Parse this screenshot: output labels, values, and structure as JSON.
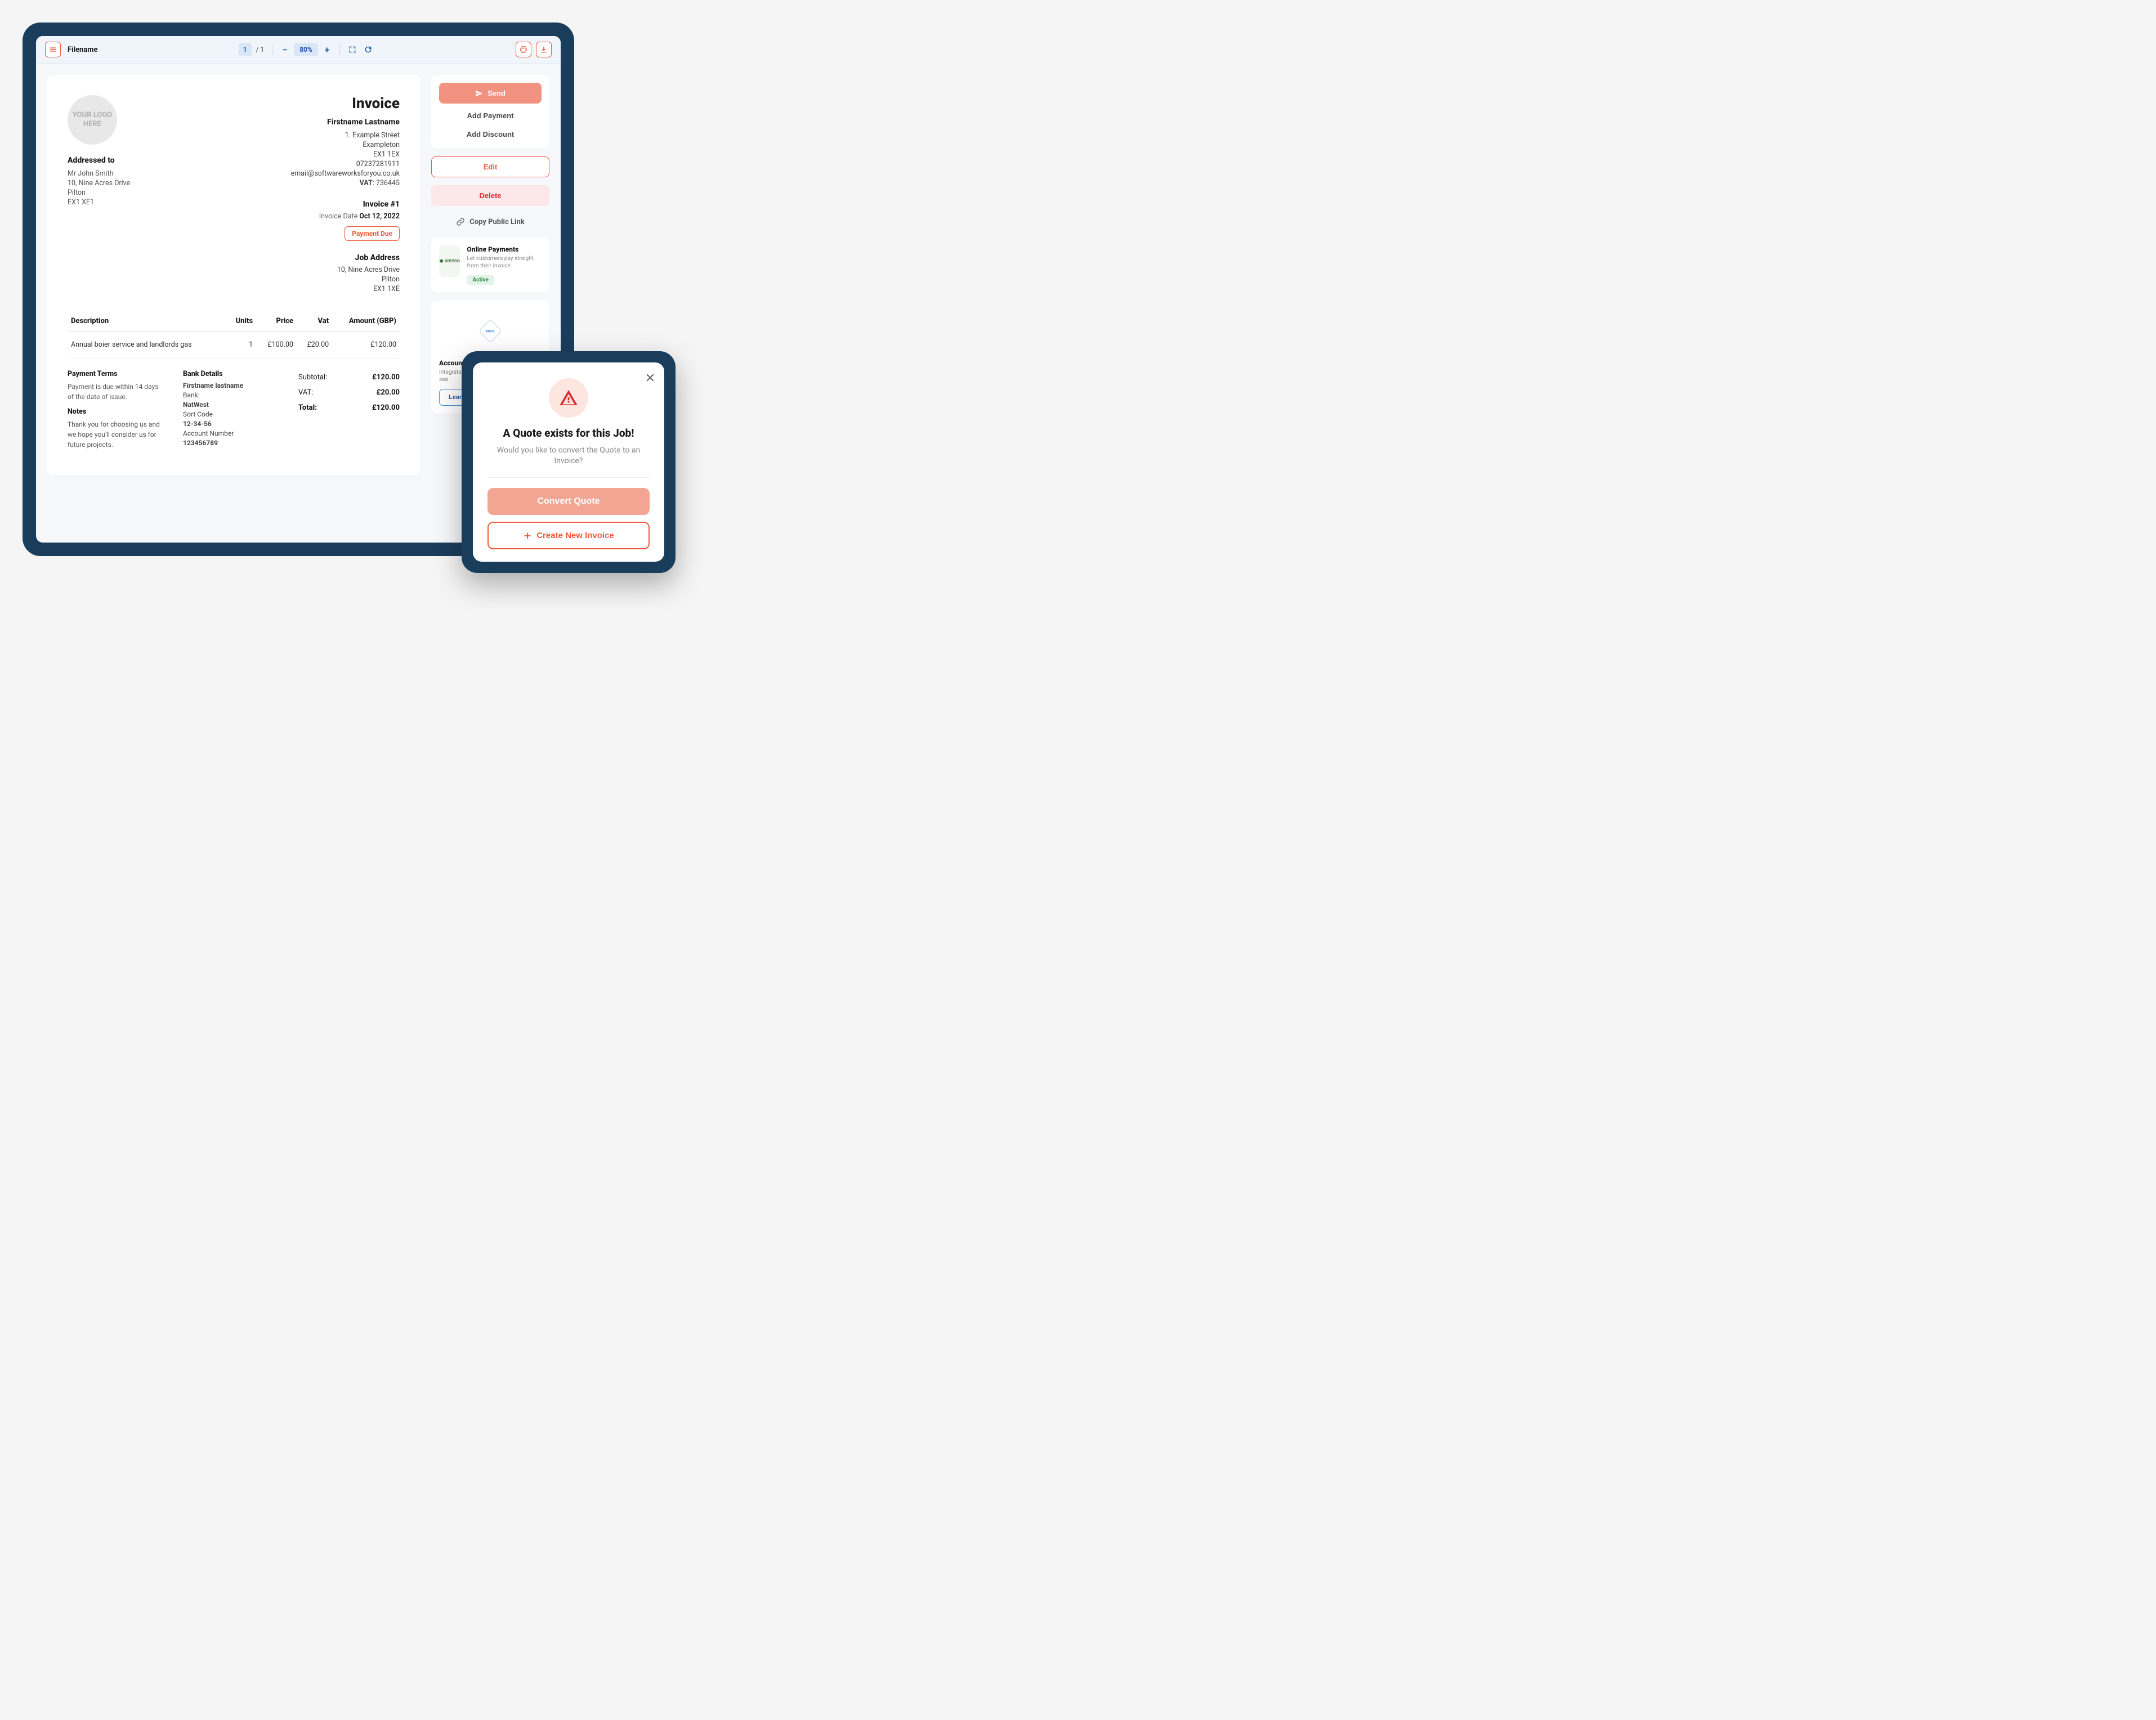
{
  "toolbar": {
    "filename": "Filename",
    "page_current": "1",
    "page_total": "/ 1",
    "zoom": "80%"
  },
  "invoice": {
    "logo_text": "YOUR LOGO HERE",
    "title": "Invoice",
    "from_name": "Firstname Lastname",
    "from_addr1": "1. Example Street",
    "from_addr2": "Exampleton",
    "from_postcode": "EX1 1EX",
    "from_phone": "07237281911",
    "from_email": "email@softwareworksforyou.co.uk",
    "vat_label": "VAT",
    "vat_number": "736445",
    "addressed_to_h": "Addressed to",
    "to_name": "Mr John Smith",
    "to_addr1": "10, Nine Acres Drive",
    "to_addr2": "Pilton",
    "to_postcode": "EX1 XE1",
    "number_h": "Invoice #1",
    "date_label": "Invoice Date ",
    "date_value": "Oct 12, 2022",
    "status_badge": "Payment Due",
    "job_h": "Job Address",
    "job_addr1": "10, Nine Acres Drive",
    "job_addr2": "Pilton",
    "job_postcode": "EX1 1XE"
  },
  "table": {
    "h_desc": "Description",
    "h_units": "Units",
    "h_price": "Price",
    "h_vat": "Vat",
    "h_amount": "Amount (GBP)",
    "row_desc": "Annual boier service and landlords gas",
    "row_units": "1",
    "row_price": "£100.00",
    "row_vat": "£20.00",
    "row_amount": "£120.00"
  },
  "footer": {
    "terms_h": "Payment Terms",
    "terms_text": "Payment is due within 14 days of the date of issue.",
    "notes_h": "Notes",
    "notes_text": "Thank you for choosing us and we hope you'll consider us for future projects.",
    "bank_h": "Bank Details",
    "bank_name_label": "Firstname lastname",
    "bank_label": "Bank:",
    "bank_name": "NatWest",
    "sort_label": "Sort Code",
    "sort_code": "12-34-56",
    "acct_label": "Account Number",
    "acct_number": "123456789",
    "subtotal_l": "Subtotal:",
    "subtotal_v": "£120.00",
    "vat_l": "VAT:",
    "vat_v": "£20.00",
    "total_l": "Total:",
    "total_v": "£120.00"
  },
  "sidebar": {
    "send": "Send",
    "add_payment": "Add Payment",
    "add_discount": "Add Discount",
    "edit": "Edit",
    "delete": "Delete",
    "copy_link": "Copy Public Link",
    "online_h": "Online Payments",
    "online_desc": "Let customers pay straight from their invoice",
    "online_badge": "Active",
    "online_logo": "◆ crezco",
    "accounts_h": "Accounts Integ",
    "accounts_desc": "Integrate with an acc your accounting sea",
    "learn_more": "Learn More",
    "xero_label": "xero"
  },
  "modal": {
    "title": "A Quote exists for this Job!",
    "body": "Would you like to convert the Quote to an Invoice?",
    "convert": "Convert Quote",
    "create": "Create New Invoice"
  }
}
